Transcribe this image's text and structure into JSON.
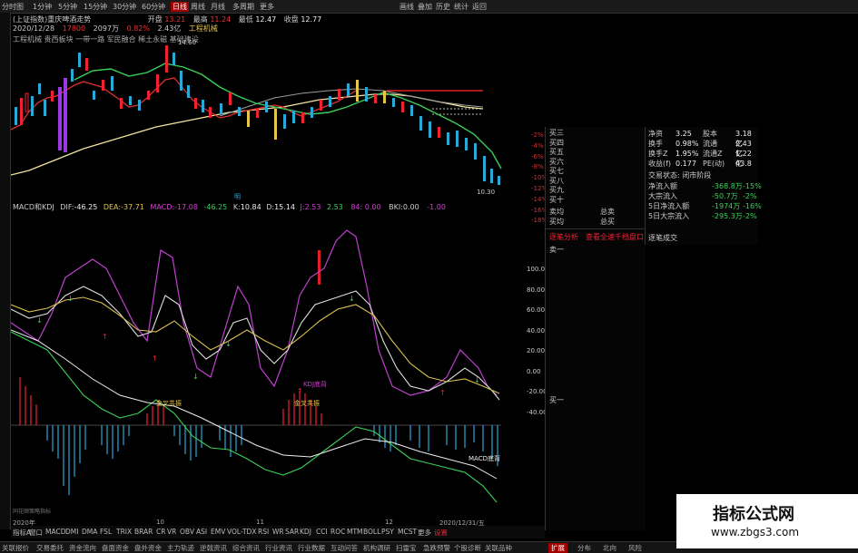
{
  "toolbar": {
    "items": [
      "分时图",
      "1分钟",
      "5分钟",
      "15分钟",
      "30分钟",
      "60分钟",
      "日线",
      "周线",
      "月线",
      "多周期",
      "更多"
    ],
    "active": "日线",
    "right_items": [
      "画线",
      "叠加",
      "历史",
      "统计",
      "返回"
    ]
  },
  "header": {
    "stock_line": "(上证指数)重庆啤酒走势",
    "open_label": "开盘",
    "open_value": "13.21",
    "high_label": "最高",
    "high_value": "11.24",
    "low_label": "最低",
    "low_value": "12.47",
    "close_label": "收盘",
    "close_value": "12.77",
    "date_line": "2020/12/28",
    "amount": "17800",
    "volume": "2097万",
    "change": "0.82%",
    "turnover": "2.43亿",
    "category": "工程机械",
    "tags": "工程机械  贵西板块  一带一路  军民融合  稀土永磁  基础建设"
  },
  "price_chart": {
    "y_labels": [
      "-2%",
      "-4%",
      "-6%",
      "-8%",
      "-10%",
      "-12%",
      "-14%",
      "-16%",
      "-18%"
    ],
    "annot_high": "14.60",
    "annot_low": "10.30",
    "annot_mid": "明"
  },
  "indicator": {
    "name": "MACD和KDJ",
    "dif_label": "DIF:",
    "dif_value": "-46.25",
    "dea_label": "DEA:",
    "dea_value": "-37.71",
    "macd_label": "MACD:",
    "macd_value": "-17.08",
    "k_label": "K:",
    "k_value": "10.84",
    "d_label": "D:",
    "d_value": "15.14",
    "j_label": "J:",
    "j_value": "2.53",
    "extra": "84: 0.00",
    "bk_label": "BKI:",
    "bk_value": "0.00",
    "neg": "-1.00",
    "y_labels": [
      "100.00",
      "80.00",
      "60.00",
      "40.00",
      "20.00",
      "0.00",
      "-20.00",
      "-40.00"
    ],
    "annotations": [
      "金叉共振",
      "金叉共振",
      "KDJ底背",
      "MACD底背"
    ],
    "footer": "同花顺策略指标"
  },
  "time_axis": [
    "2020年",
    "10",
    "11",
    "12",
    "2020/12/31/五"
  ],
  "right_panel": {
    "sells": [
      "买三",
      "买四",
      "买五",
      "买六",
      "买七",
      "买八",
      "买九",
      "买十"
    ],
    "buy_avg": "卖均",
    "total_sell": "总卖",
    "buy_avg2": "买均",
    "total_buy": "总买",
    "tabs": [
      "逐笔分析",
      "查看全速千档盘口"
    ],
    "sell_one": "卖一",
    "buy_one": "买一"
  },
  "stats_panel": {
    "rows": [
      {
        "l1": "净资",
        "v1": "3.25",
        "l2": "股本",
        "v2": "3.18亿"
      },
      {
        "l1": "换手",
        "v1": "0.98%",
        "l2": "流通",
        "v2": "2.43亿"
      },
      {
        "l1": "换手Z",
        "v1": "1.95%",
        "l2": "流通Z",
        "v2": "1.22亿"
      },
      {
        "l1": "收益(f)",
        "v1": "0.177",
        "l2": "PE(动)",
        "v2": "43.8"
      }
    ],
    "status": "交易状态: 闭市阶段",
    "flows": [
      {
        "label": "净流入额",
        "value": "-368.8万",
        "pct": "-15%"
      },
      {
        "label": "大宗流入",
        "value": "-50.7万",
        "pct": "-2%"
      },
      {
        "label": "5日净流入额",
        "value": "-1974万",
        "pct": "-16%"
      },
      {
        "label": "5日大宗流入",
        "value": "-295.3万",
        "pct": "-2%"
      }
    ],
    "tick_title": "逐笔成交"
  },
  "indicator_tabs": [
    "指标A",
    "窗口",
    "MACD",
    "DMI",
    "DMA",
    "FSL",
    "TRIX",
    "BRAR",
    "CR",
    "VR",
    "OBV",
    "ASI",
    "EMV",
    "VOL-TDX",
    "RSI",
    "WR",
    "SAR",
    "KDJ",
    "CCI",
    "ROC",
    "MTM",
    "BOLL",
    "PSY",
    "MCST",
    "更多",
    "设置"
  ],
  "bottom_tabs": [
    "关联报价",
    "交易委托",
    "资金流向",
    "盘面资金",
    "盘外资金",
    "主力轨迹",
    "逆戟资讯",
    "综合资讯",
    "行业资讯",
    "行业数据",
    "互动问答",
    "机构调研",
    "扫雷宝",
    "急跌预警",
    "个股诊断",
    "关联品种"
  ],
  "right_bottom_tabs": [
    "扩展",
    "分布",
    "北向",
    "风险"
  ],
  "watermark": {
    "title": "指标公式网",
    "url": "www.zbgs3.com"
  }
}
